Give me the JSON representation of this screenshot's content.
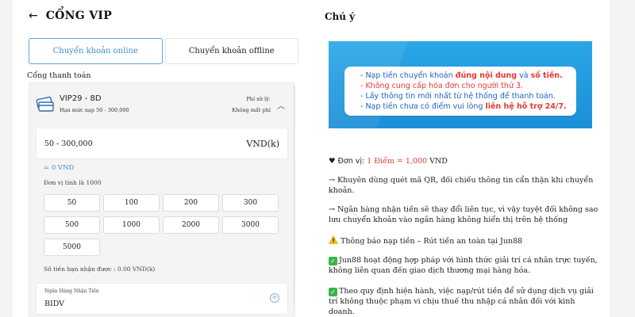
{
  "header": {
    "back_icon": "arrow-left-icon",
    "title": "CỔNG VIP"
  },
  "tabs": [
    {
      "label": "Chuyển khoản online",
      "active": true
    },
    {
      "label": "Chuyển khoản offline",
      "active": false
    }
  ],
  "gateway": {
    "label": "Cổng thanh toán",
    "method": {
      "name": "VIP29 - 8D",
      "limit": "Hạn mức nạp 50 - 300,000",
      "fee_label": "Phí xử lý:",
      "fee_value": "Không mất phí"
    }
  },
  "amount": {
    "range": "50 - 300,000",
    "unit": "VND(k)",
    "equivalent": "= 0 VND",
    "unit_note": "Đơn vị tính là 1000",
    "presets": [
      "50",
      "100",
      "200",
      "300",
      "500",
      "1000",
      "2000",
      "3000",
      "5000"
    ],
    "received": "Số tiền bạn nhận được : 0.00 VND(k)"
  },
  "bank": {
    "label": "Ngân Hàng Nhận Tiền",
    "value": "BIDV"
  },
  "notes": {
    "title": "Chú ý",
    "banner": {
      "l1a": "- Nạp tiền chuyển khoản ",
      "l1b": "đúng nội dung",
      "l1c": " và ",
      "l1d": "số tiền.",
      "l2": "- Không cung cấp hóa đơn cho người thứ 3.",
      "l3a": "- Lấy thông tin mới nhất ",
      "l3b": "từ hệ thống để thanh toán.",
      "l4a": "- Nạp tiền chưa có điểm vui lòng ",
      "l4b": "liên hệ hỗ trợ 24/7."
    },
    "unit_prefix": "♥ Đơn vị: ",
    "unit_value": "1 Điểm = 1,000",
    "unit_suffix": " VND",
    "p1": "→ Khuyên dùng quét mã QR, đối chiếu thông tin cẩn thận khi chuyển khoản.",
    "p2": "→ Ngân hàng nhận tiền sẽ thay đổi liên tục, vì vậy tuyệt đối không sao lưu chuyển khoản vào ngân hàng không hiển thị trên hệ thống",
    "p3": "Thông báo nạp tiền – Rút tiền an toàn tại Jun88",
    "p4": "Jun88 hoạt động hợp pháp với hình thức giải trí cá nhân trực tuyến, không liên quan đến giao dịch thương mại hàng hóa.",
    "p5": "Theo quy định hiện hành, việc nạp/rút tiền để sử dụng dịch vụ giải trí không thuộc phạm vi chịu thuế thu nhập cá nhân đối với kinh doanh."
  },
  "colors": {
    "accent": "#3f8fcc",
    "banner_blue": "#1b8fd8",
    "highlight_red": "#e53935",
    "check_green": "#3cb44a"
  }
}
